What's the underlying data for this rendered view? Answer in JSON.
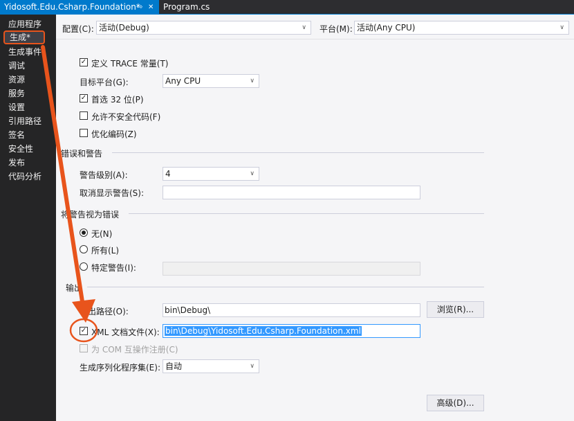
{
  "tabs": [
    {
      "label": "Yidosoft.Edu.Csharp.Foundation*",
      "pin": "⇨",
      "close": "✕"
    },
    {
      "label": "Program.cs"
    }
  ],
  "sidebar": {
    "items": [
      "应用程序",
      "生成*",
      "生成事件",
      "调试",
      "资源",
      "服务",
      "设置",
      "引用路径",
      "签名",
      "安全性",
      "发布",
      "代码分析"
    ]
  },
  "config": {
    "config_label": "配置(C):",
    "config_value": "活动(Debug)",
    "platform_label": "平台(M):",
    "platform_value": "活动(Any CPU)"
  },
  "general": {
    "trace_label": "定义 TRACE 常量(T)",
    "target_label": "目标平台(G):",
    "target_value": "Any CPU",
    "prefer32_label": "首选 32 位(P)",
    "unsafe_label": "允许不安全代码(F)",
    "optimize_label": "优化编码(Z)"
  },
  "errors": {
    "section_label": "错误和警告",
    "level_label": "警告级别(A):",
    "level_value": "4",
    "suppress_label": "取消显示警告(S):",
    "suppress_value": ""
  },
  "treat": {
    "section_label": "将警告视为错误",
    "none_label": "无(N)",
    "all_label": "所有(L)",
    "specific_label": "特定警告(I):",
    "specific_value": ""
  },
  "output": {
    "section_label": "输出",
    "path_label": "输出路径(O):",
    "path_value": "bin\\Debug\\",
    "browse_label": "浏览(R)...",
    "xml_label": "XML 文档文件(X):",
    "xml_value": "bin\\Debug\\Yidosoft.Edu.Csharp.Foundation.xml",
    "com_label": "为 COM 互操作注册(C)",
    "serial_label": "生成序列化程序集(E):",
    "serial_value": "自动",
    "advanced_label": "高级(D)..."
  },
  "state": {
    "trace_checked": true,
    "prefer32_checked": true,
    "unsafe_checked": false,
    "optimize_checked": false,
    "xml_checked": true,
    "com_checked": false,
    "treat_selected": "none"
  },
  "colors": {
    "accent": "#007acc",
    "annotation": "#e8541c",
    "sidebar_bg": "#252526",
    "selection": "#3399ff"
  },
  "check_glyph": "✓",
  "dropdown_glyph": "∨"
}
